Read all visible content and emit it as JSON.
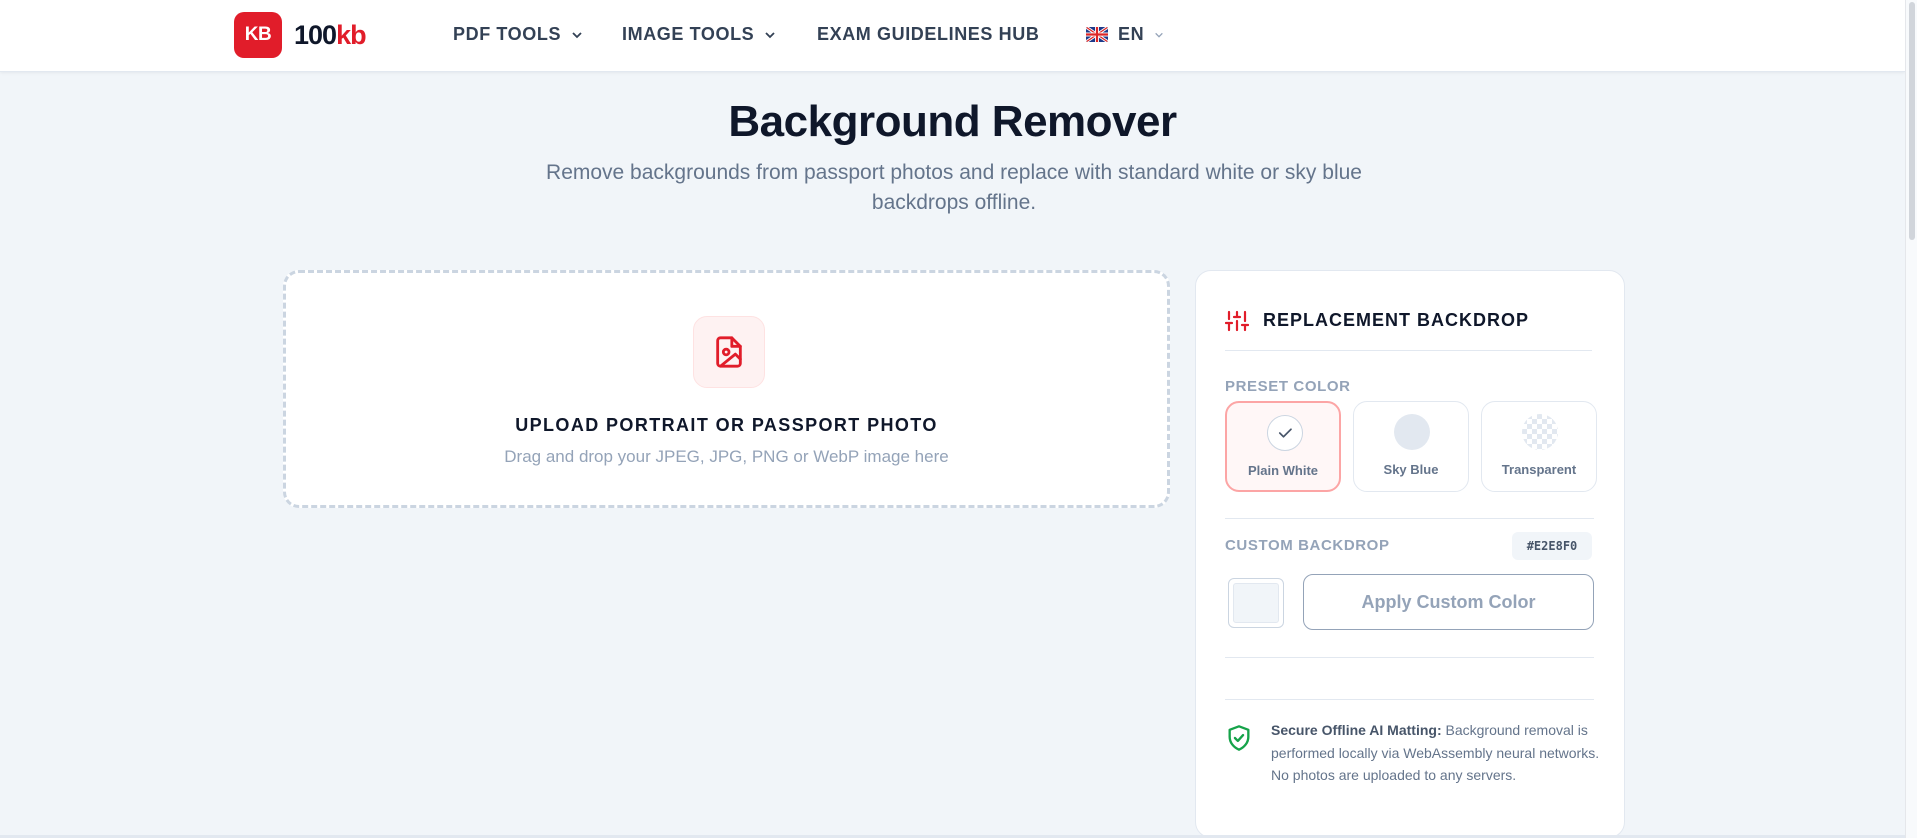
{
  "brand": {
    "badge": "KB",
    "name_part1": "100",
    "name_part2": "kb",
    "color": "#e11d2a"
  },
  "nav": {
    "pdf_tools": "PDF TOOLS",
    "image_tools": "IMAGE TOOLS",
    "exam_hub": "EXAM GUIDELINES HUB",
    "language": "EN"
  },
  "page": {
    "title": "Background Remover",
    "subtitle": "Remove backgrounds from passport photos and replace with standard white or sky blue backdrops offline."
  },
  "upload": {
    "title": "UPLOAD PORTRAIT OR PASSPORT PHOTO",
    "subtitle": "Drag and drop your JPEG, JPG, PNG or WebP image here"
  },
  "panel": {
    "title": "REPLACEMENT BACKDROP",
    "preset_label": "PRESET COLOR",
    "presets": [
      {
        "name": "Plain White",
        "color": "#ffffff",
        "selected": true
      },
      {
        "name": "Sky Blue",
        "color": "#e2e8f0",
        "selected": false
      },
      {
        "name": "Transparent",
        "color": "checker",
        "selected": false
      }
    ],
    "custom_label": "CUSTOM BACKDROP",
    "custom_hex": "#E2E8F0",
    "apply_label": "Apply Custom Color",
    "secure_title": "Secure Offline AI Matting:",
    "secure_body": " Background removal is performed locally via WebAssembly neural networks. No photos are uploaded to any servers."
  }
}
